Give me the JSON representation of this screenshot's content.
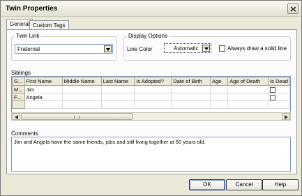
{
  "window": {
    "title": "Twin Properties"
  },
  "tabs": [
    {
      "label": "General",
      "active": true
    },
    {
      "label": "Custom Tags",
      "active": false
    }
  ],
  "twin_link": {
    "group_label": "Twin Link",
    "value": "Fraternal"
  },
  "display_options": {
    "group_label": "Display Options",
    "line_color_label": "Line Color",
    "line_color_value": "Automatic",
    "always_solid_label": "Always draw a solid line",
    "always_solid_checked": false
  },
  "siblings": {
    "label": "Siblings",
    "columns": [
      "G...",
      "First Name",
      "Middle Name",
      "Last Name",
      "Is Adopted?",
      "Date of Birth",
      "Age",
      "Age of Death",
      "Is Dead"
    ],
    "rows": [
      {
        "row_header": "M...",
        "first_name": "Jim",
        "middle_name": "",
        "last_name": "",
        "is_adopted": "",
        "dob": "",
        "age": "",
        "age_of_death": "",
        "is_dead": false
      },
      {
        "row_header": "F...",
        "first_name": "Angela",
        "middle_name": "",
        "last_name": "",
        "is_adopted": "",
        "dob": "",
        "age": "",
        "age_of_death": "",
        "is_dead": false
      }
    ]
  },
  "comments": {
    "label": "Comments",
    "text": "Jim and Angela have the same friends, jobs and still living together at 50 years old."
  },
  "buttons": {
    "ok": "OK",
    "cancel": "Cancel",
    "help": "Help"
  }
}
